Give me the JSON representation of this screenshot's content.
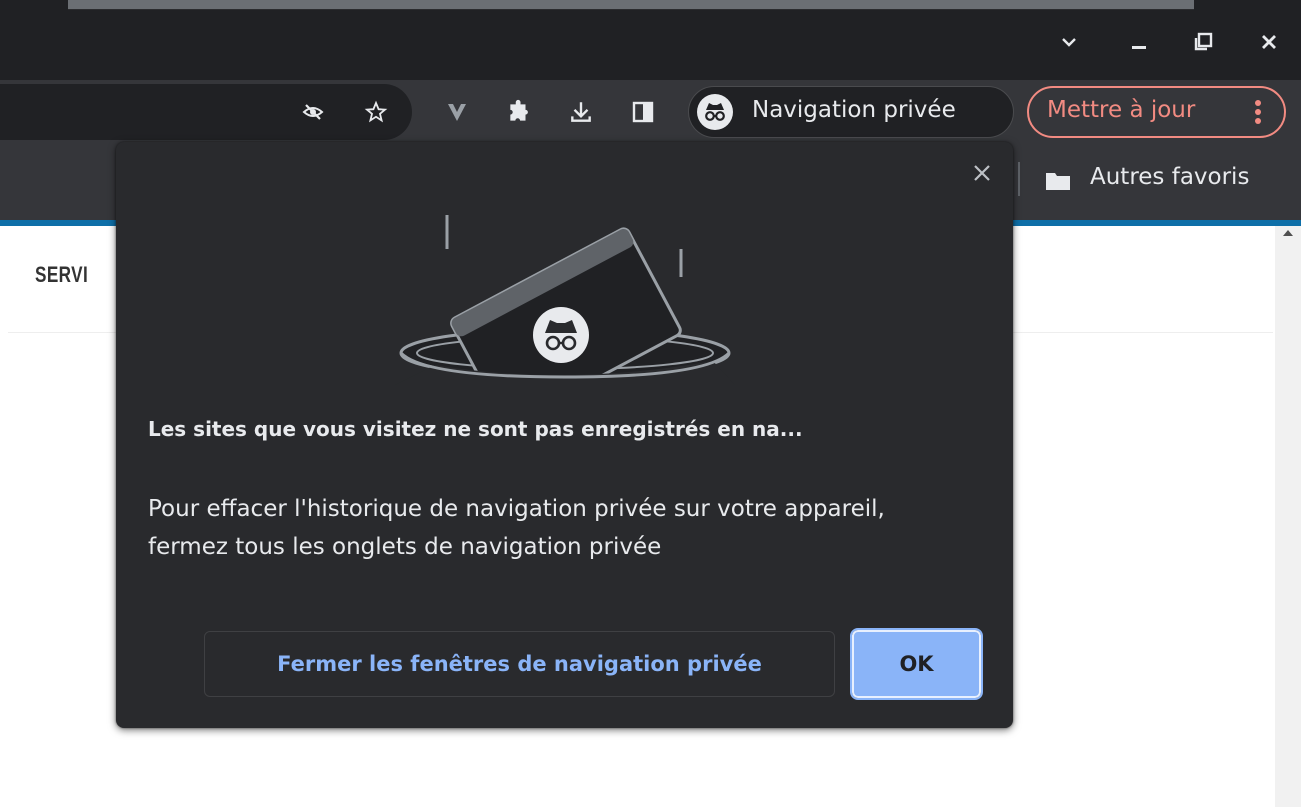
{
  "window": {
    "controls": [
      "chevron-down-icon",
      "minimize-icon",
      "restore-icon",
      "close-icon"
    ]
  },
  "toolbar": {
    "icons": [
      "eye-off-icon",
      "star-icon",
      "vivaldi-extension-icon",
      "puzzle-icon",
      "download-icon",
      "side-panel-icon"
    ],
    "incognito_label": "Navigation privée",
    "update_label": "Mettre à jour",
    "update_color": "#f28b82"
  },
  "bookmarks_bar": {
    "other_bookmarks_label": "Autres favoris"
  },
  "page": {
    "nav_item_label": "SERVI"
  },
  "popup": {
    "title": "Les sites que vous visitez ne sont pas enregistrés en na...",
    "body": "Pour effacer l'historique de navigation privée sur votre appareil, fermez tous les onglets de navigation privée",
    "close_windows_label": "Fermer les fenêtres de navigation privée",
    "ok_label": "OK",
    "accent_color": "#8ab4f8",
    "background_color": "#292a2d"
  }
}
